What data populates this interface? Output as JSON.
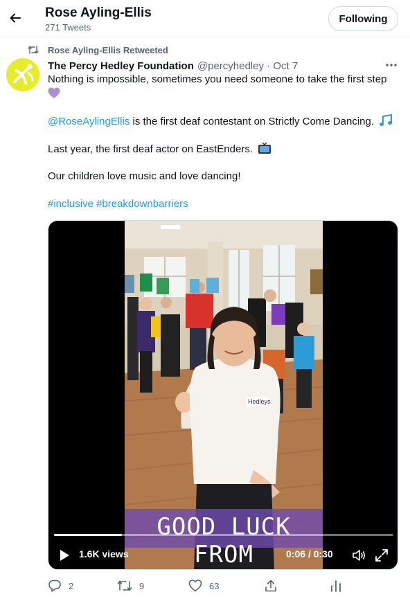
{
  "header": {
    "name": "Rose Ayling-Ellis",
    "tweet_count": "271 Tweets",
    "follow_label": "Following",
    "back_icon": "arrow-left-icon"
  },
  "retweet": {
    "label": "Rose Ayling-Ellis Retweeted",
    "icon": "retweet-icon"
  },
  "tweet": {
    "author_name": "The Percy Hedley Foundation",
    "author_meta": "@percyhedley · Oct 7",
    "avatar_icon": "foundation-logo-icon",
    "avatar_color": "#e6eb2c",
    "line1": "Nothing is impossible, sometimes you need someone to take the first step",
    "line1_emoji": "purple-heart-icon",
    "mention": "@RoseAylingEllis",
    "line2_rest": " is the first deaf contestant on Strictly Come Dancing.",
    "line2_emoji": "music-notes-icon",
    "line3": "Last year, the first deaf actor on EastEnders.",
    "line3_emoji": "television-icon",
    "line4": "Our children love music and love dancing!",
    "hashtag1": "#inclusive",
    "hashtag2": "#breakdownbarriers",
    "link_color": "#1d9bf0"
  },
  "video": {
    "banner_text": "GOOD LUCK FROM",
    "views": "1.6K views",
    "time": "0:06 / 0:30",
    "progress": 0.2,
    "play_icon": "play-icon",
    "volume_icon": "volume-icon",
    "fullscreen_icon": "fullscreen-icon",
    "shirt_logo": "Hedleys"
  },
  "actions": {
    "reply_count": "2",
    "retweet_count": "9",
    "like_count": "63"
  }
}
